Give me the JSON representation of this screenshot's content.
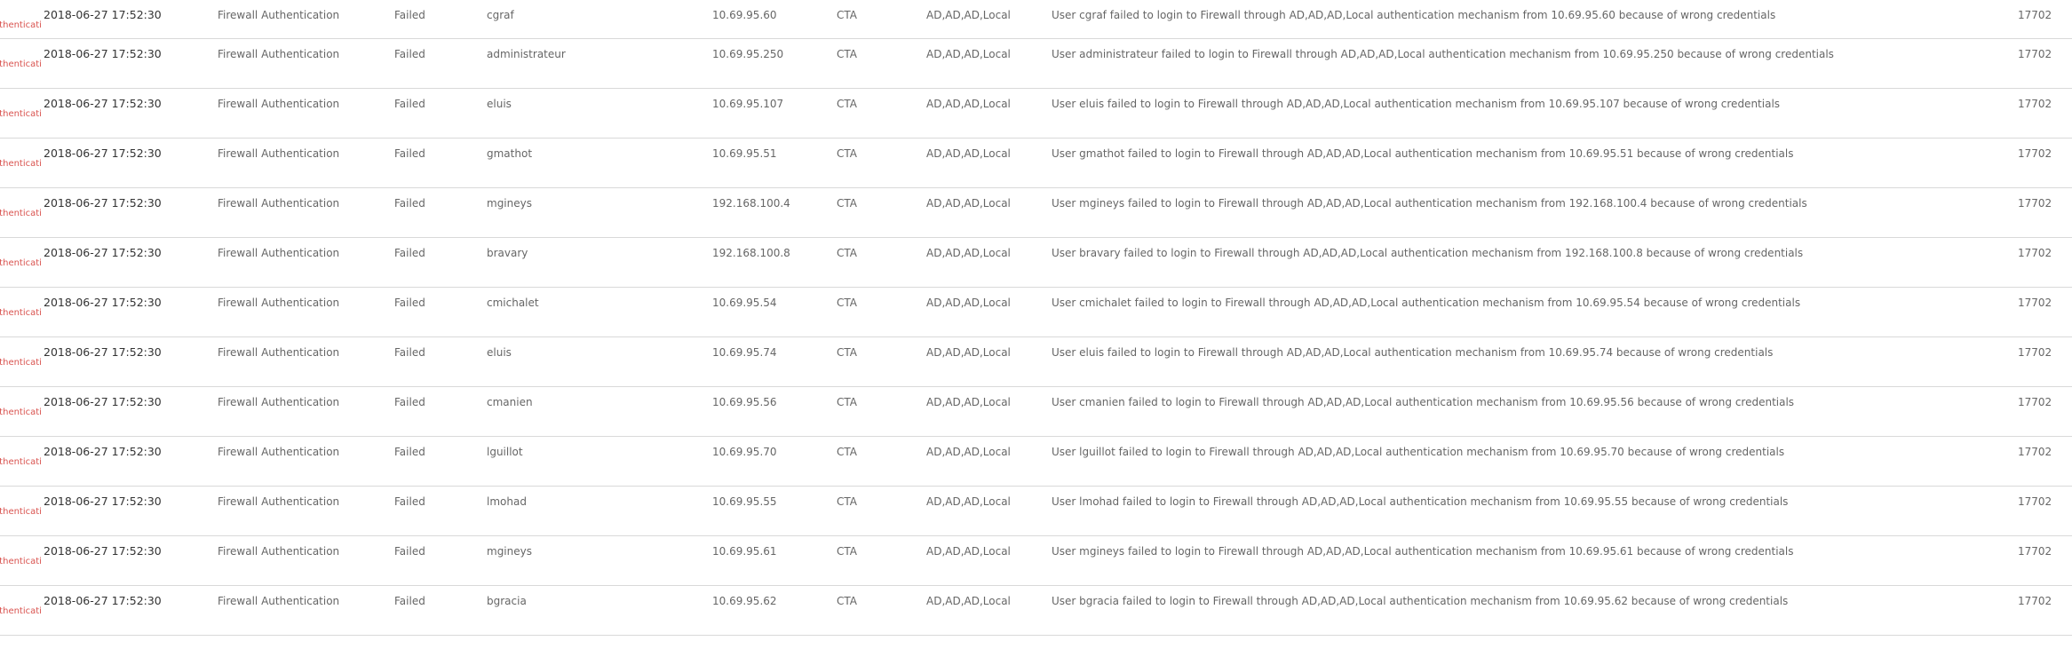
{
  "log": {
    "tag_label": "Authentication",
    "rows": [
      {
        "time": "2018-06-27 17:52:30",
        "module": "Firewall Authentication",
        "status": "Failed",
        "user": "cgraf",
        "ip": "10.69.95.60",
        "origin": "CTA",
        "mechanism": "AD,AD,AD,Local",
        "message": "User cgraf failed to login to Firewall through AD,AD,AD,Local authentication mechanism from 10.69.95.60 because of wrong credentials",
        "id": "17702"
      },
      {
        "time": "2018-06-27 17:52:30",
        "module": "Firewall Authentication",
        "status": "Failed",
        "user": "administrateur",
        "ip": "10.69.95.250",
        "origin": "CTA",
        "mechanism": "AD,AD,AD,Local",
        "message": "User administrateur failed to login to Firewall through AD,AD,AD,Local authentication mechanism from 10.69.95.250 because of wrong credentials",
        "id": "17702"
      },
      {
        "time": "2018-06-27 17:52:30",
        "module": "Firewall Authentication",
        "status": "Failed",
        "user": "eluis",
        "ip": "10.69.95.107",
        "origin": "CTA",
        "mechanism": "AD,AD,AD,Local",
        "message": "User eluis failed to login to Firewall through AD,AD,AD,Local authentication mechanism from 10.69.95.107 because of wrong credentials",
        "id": "17702"
      },
      {
        "time": "2018-06-27 17:52:30",
        "module": "Firewall Authentication",
        "status": "Failed",
        "user": "gmathot",
        "ip": "10.69.95.51",
        "origin": "CTA",
        "mechanism": "AD,AD,AD,Local",
        "message": "User gmathot failed to login to Firewall through AD,AD,AD,Local authentication mechanism from 10.69.95.51 because of wrong credentials",
        "id": "17702"
      },
      {
        "time": "2018-06-27 17:52:30",
        "module": "Firewall Authentication",
        "status": "Failed",
        "user": "mgineys",
        "ip": "192.168.100.4",
        "origin": "CTA",
        "mechanism": "AD,AD,AD,Local",
        "message": "User mgineys failed to login to Firewall through AD,AD,AD,Local authentication mechanism from 192.168.100.4 because of wrong credentials",
        "id": "17702"
      },
      {
        "time": "2018-06-27 17:52:30",
        "module": "Firewall Authentication",
        "status": "Failed",
        "user": "bravary",
        "ip": "192.168.100.8",
        "origin": "CTA",
        "mechanism": "AD,AD,AD,Local",
        "message": "User bravary failed to login to Firewall through AD,AD,AD,Local authentication mechanism from 192.168.100.8 because of wrong credentials",
        "id": "17702"
      },
      {
        "time": "2018-06-27 17:52:30",
        "module": "Firewall Authentication",
        "status": "Failed",
        "user": "cmichalet",
        "ip": "10.69.95.54",
        "origin": "CTA",
        "mechanism": "AD,AD,AD,Local",
        "message": "User cmichalet failed to login to Firewall through AD,AD,AD,Local authentication mechanism from 10.69.95.54 because of wrong credentials",
        "id": "17702"
      },
      {
        "time": "2018-06-27 17:52:30",
        "module": "Firewall Authentication",
        "status": "Failed",
        "user": "eluis",
        "ip": "10.69.95.74",
        "origin": "CTA",
        "mechanism": "AD,AD,AD,Local",
        "message": "User eluis failed to login to Firewall through AD,AD,AD,Local authentication mechanism from 10.69.95.74 because of wrong credentials",
        "id": "17702"
      },
      {
        "time": "2018-06-27 17:52:30",
        "module": "Firewall Authentication",
        "status": "Failed",
        "user": "cmanien",
        "ip": "10.69.95.56",
        "origin": "CTA",
        "mechanism": "AD,AD,AD,Local",
        "message": "User cmanien failed to login to Firewall through AD,AD,AD,Local authentication mechanism from 10.69.95.56 because of wrong credentials",
        "id": "17702"
      },
      {
        "time": "2018-06-27 17:52:30",
        "module": "Firewall Authentication",
        "status": "Failed",
        "user": "lguillot",
        "ip": "10.69.95.70",
        "origin": "CTA",
        "mechanism": "AD,AD,AD,Local",
        "message": "User lguillot failed to login to Firewall through AD,AD,AD,Local authentication mechanism from 10.69.95.70 because of wrong credentials",
        "id": "17702"
      },
      {
        "time": "2018-06-27 17:52:30",
        "module": "Firewall Authentication",
        "status": "Failed",
        "user": "lmohad",
        "ip": "10.69.95.55",
        "origin": "CTA",
        "mechanism": "AD,AD,AD,Local",
        "message": "User lmohad failed to login to Firewall through AD,AD,AD,Local authentication mechanism from 10.69.95.55 because of wrong credentials",
        "id": "17702"
      },
      {
        "time": "2018-06-27 17:52:30",
        "module": "Firewall Authentication",
        "status": "Failed",
        "user": "mgineys",
        "ip": "10.69.95.61",
        "origin": "CTA",
        "mechanism": "AD,AD,AD,Local",
        "message": "User mgineys failed to login to Firewall through AD,AD,AD,Local authentication mechanism from 10.69.95.61 because of wrong credentials",
        "id": "17702"
      },
      {
        "time": "2018-06-27 17:52:30",
        "module": "Firewall Authentication",
        "status": "Failed",
        "user": "bgracia",
        "ip": "10.69.95.62",
        "origin": "CTA",
        "mechanism": "AD,AD,AD,Local",
        "message": "User bgracia failed to login to Firewall through AD,AD,AD,Local authentication mechanism from 10.69.95.62 because of wrong credentials",
        "id": "17702"
      }
    ]
  }
}
